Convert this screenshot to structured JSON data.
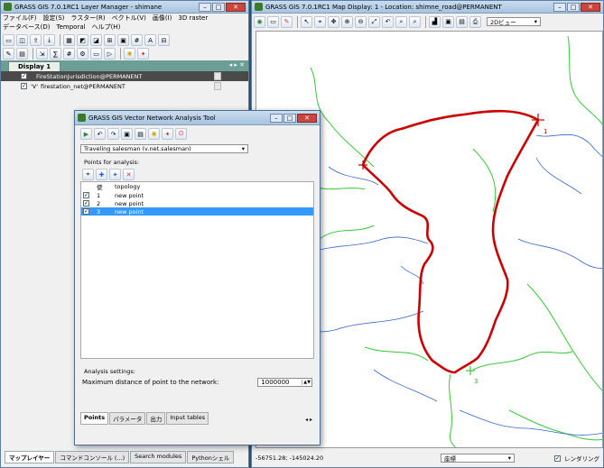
{
  "layer_manager": {
    "title": "GRASS GIS 7.0.1RC1 Layer Manager - shimane",
    "menu": [
      "ファイル(F)",
      "設定(S)",
      "ラスター(R)",
      "ベクトル(V)",
      "画像(I)",
      "3D raster",
      "データベース(D)",
      "Temporal",
      "ヘルプ(H)"
    ],
    "display_tab": "Display 1",
    "layers": [
      {
        "name": "FireStationJurisdiction@PERMANENT",
        "checked": "✓"
      },
      {
        "name": "firestation_net@PERMANENT",
        "checked": "✓"
      }
    ],
    "bottom_tabs": [
      "マップレイヤー",
      "コマンドコンソール (...)",
      "Search modules",
      "Pythonシェル"
    ]
  },
  "map_display": {
    "title": "GRASS GIS 7.0.1RC1 Map Display: 1  - Location: shimne_road@PERMANENT",
    "view_mode": "2Dビュー",
    "coordinates": "-56751.28; -145024.20",
    "status_mode": "座標",
    "render_label": "レンダリング",
    "render_checked": "✓",
    "route_color": "#cc0000",
    "network_color": "#3366cc",
    "jurisdiction_color": "#33cc33",
    "point_labels": [
      "1",
      "3"
    ]
  },
  "dialog": {
    "title": "GRASS GIS Vector Network Analysis Tool",
    "analysis_select": "Traveling salesman (v.net.salesman)",
    "points_label": "Points for analysis:",
    "columns": [
      "使",
      "topology"
    ],
    "points": [
      {
        "check": "✓",
        "id": "1",
        "topology": "new point"
      },
      {
        "check": "✓",
        "id": "2",
        "topology": "new point"
      },
      {
        "check": "✓",
        "id": "3",
        "topology": "new point"
      }
    ],
    "settings_label": "Analysis settings:",
    "max_distance_label": "Maximum distance of point to the network:",
    "max_distance_value": "1000000",
    "tabs": [
      "Points",
      "パラメータ",
      "出力",
      "Input tables"
    ]
  }
}
